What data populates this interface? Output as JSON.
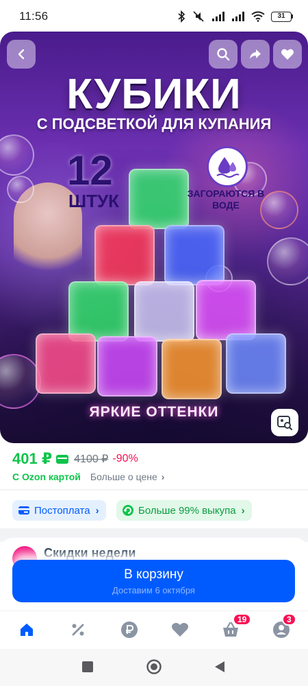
{
  "status_bar": {
    "time": "11:56",
    "battery": "31"
  },
  "product_image": {
    "headline": "КУБИКИ",
    "subline": "С ПОДСВЕТКОЙ ДЛЯ КУПАНИЯ",
    "count_number": "12",
    "count_label": "ШТУК",
    "glow_text": "ЗАГОРАЮТСЯ В ВОДЕ",
    "caption": "ЯРКИЕ ОТТЕНКИ",
    "cube_colors": [
      "#33e06a",
      "#ff3a55",
      "#4a6bff",
      "#33e06a",
      "#d9d4ff",
      "#e353ff",
      "#ff4f8c",
      "#d24cff",
      "#ff9a2e",
      "#6f8cff"
    ]
  },
  "price": {
    "current": "401 ₽",
    "old": "4100 ₽",
    "discount": "-90%",
    "ozon_card": "С Ozon картой",
    "more": "Больше о цене"
  },
  "chips": {
    "postpay": "Постоплата",
    "buyout": "Больше 99% выкупа"
  },
  "deals": {
    "title": "Скидки недели"
  },
  "cart_button": {
    "label": "В корзину",
    "sub": "Доставим 6 октября"
  },
  "bottom_nav": {
    "cart_badge": "19",
    "profile_badge": "3"
  },
  "colors": {
    "accent": "#005bff",
    "price_green": "#10c44c",
    "discount_red": "#f91155"
  }
}
